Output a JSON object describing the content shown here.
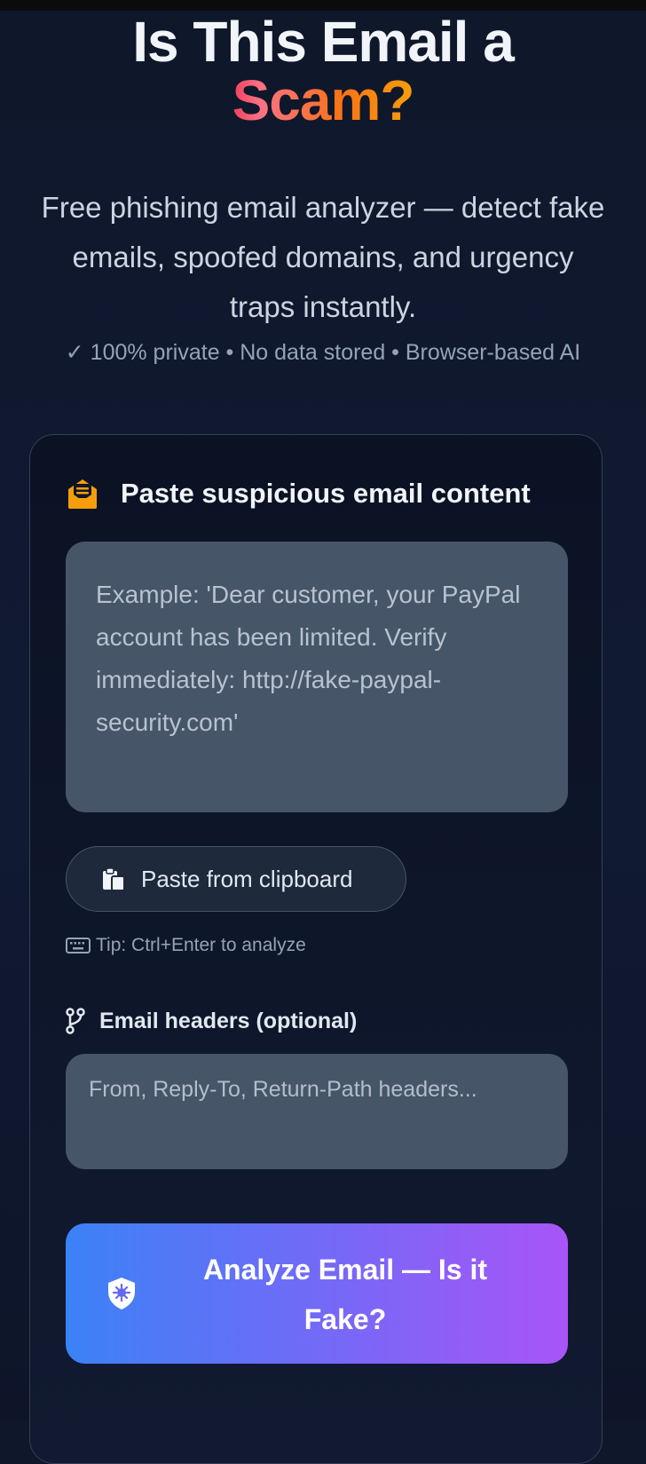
{
  "hero": {
    "title_line1": "Is This Email a",
    "title_accent": "Scam?",
    "subtitle": "Free phishing email analyzer — detect fake emails, spoofed domains, and urgency traps instantly.",
    "privacy_note": "✓ 100% private • No data stored • Browser-based AI"
  },
  "card": {
    "heading": "Paste suspicious email content",
    "heading_icon": "envelope-open-text-icon",
    "email_input": {
      "value": "",
      "placeholder": "Example: 'Dear customer, your PayPal account has been limited. Verify immediately: http://fake-paypal-security.com'"
    },
    "paste_button": {
      "label": "Paste from clipboard",
      "icon": "clipboard-icon"
    },
    "tip": {
      "text": "Tip: Ctrl+Enter to analyze",
      "icon": "keyboard-icon"
    },
    "headers": {
      "label": "Email headers (optional)",
      "icon": "code-branch-icon",
      "placeholder": "From, Reply-To, Return-Path headers..."
    },
    "analyze_button": {
      "label": "Analyze Email — Is it Fake?",
      "icon": "shield-virus-icon"
    }
  },
  "colors": {
    "background": "#0f172a",
    "accent_start": "#f43f5e",
    "accent_end": "#f59e0b",
    "button_gradient_start": "#3b82f6",
    "button_gradient_end": "#a855f7",
    "envelope_icon": "#f59e0b",
    "input_bg": "#475569"
  }
}
